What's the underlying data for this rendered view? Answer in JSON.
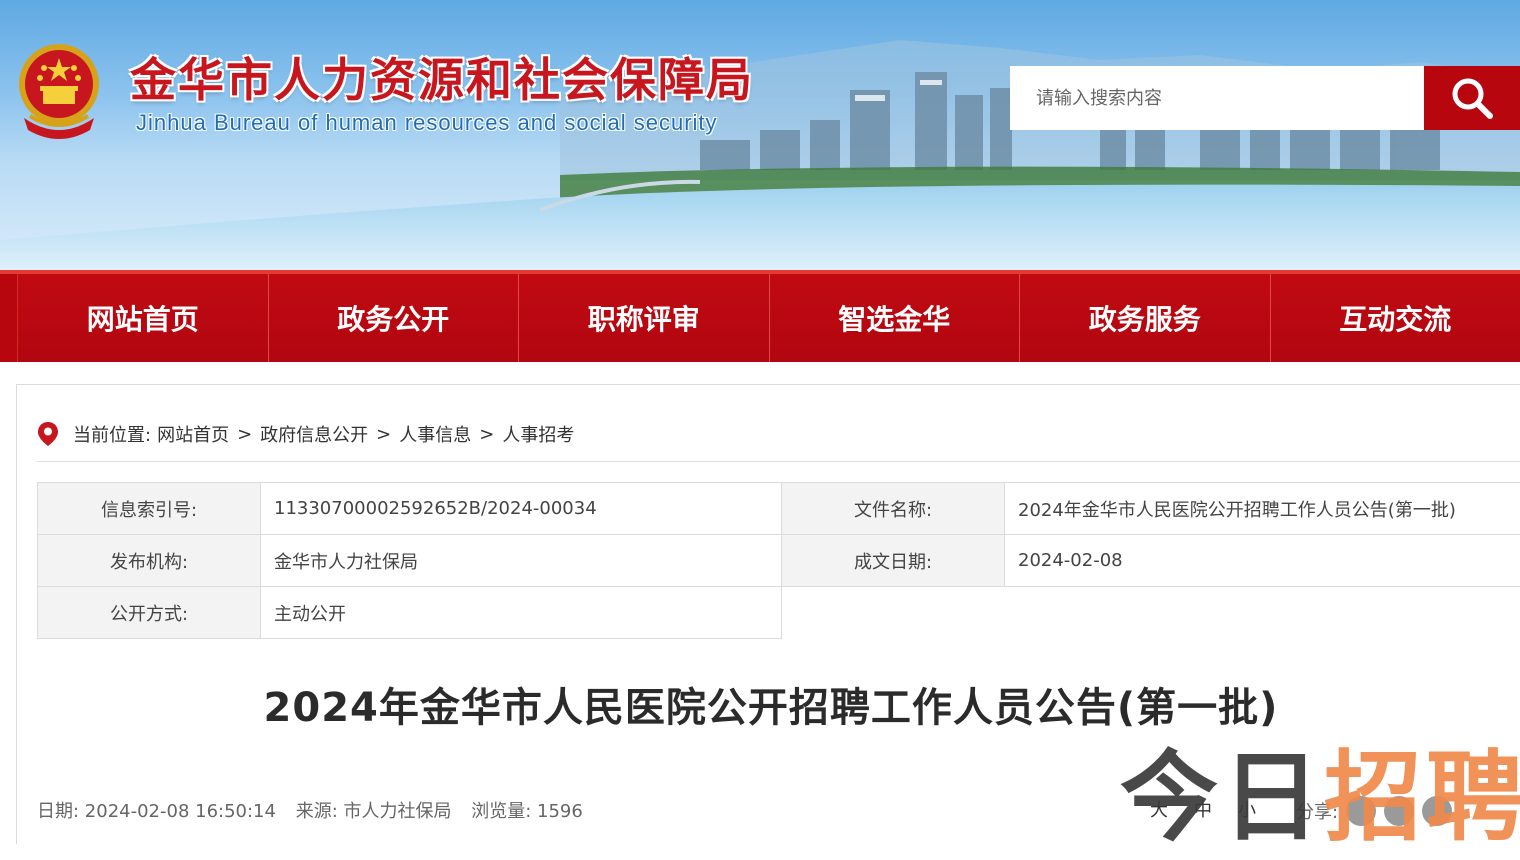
{
  "header": {
    "title": "金华市人力资源和社会保障局",
    "subtitle": "Jinhua Bureau of human resources and social security",
    "search_placeholder": "请输入搜索内容",
    "search_icon": "search-icon"
  },
  "nav": {
    "items": [
      "网站首页",
      "政务公开",
      "职称评审",
      "智选金华",
      "政务服务",
      "互动交流"
    ]
  },
  "breadcrumb": {
    "prefix": "当前位置:",
    "items": [
      "网站首页",
      "政府信息公开",
      "人事信息",
      "人事招考"
    ],
    "separator": ">"
  },
  "info": {
    "index_label": "信息索引号:",
    "index_value": "11330700002592652B/2024-00034",
    "filename_label": "文件名称:",
    "filename_value": "2024年金华市人民医院公开招聘工作人员公告(第一批)",
    "publisher_label": "发布机构:",
    "publisher_value": "金华市人力社保局",
    "date_label": "成文日期:",
    "date_value": "2024-02-08",
    "mode_label": "公开方式:",
    "mode_value": "主动公开"
  },
  "article": {
    "title": "2024年金华市人民医院公开招聘工作人员公告(第一批)"
  },
  "meta": {
    "date": "日期: 2024-02-08 16:50:14",
    "source": "来源: 市人力社保局",
    "views": "浏览量: 1596",
    "size_large": "大",
    "size_medium": "中",
    "size_small": "小",
    "share_label": "分享:"
  },
  "watermark": {
    "part1": "今日",
    "part2": "招聘"
  },
  "colors": {
    "brand_red": "#b8060f",
    "title_red": "#c8161e",
    "subtitle_blue": "#1e6db6"
  }
}
